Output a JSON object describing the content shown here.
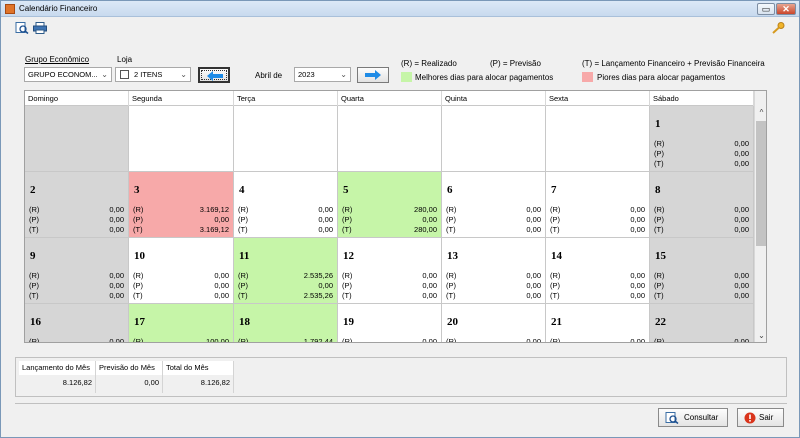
{
  "window": {
    "title": "Calendário Financeiro"
  },
  "filters": {
    "grupo_label": "Grupo Econômico",
    "grupo_value": "GRUPO ECONOM...",
    "loja_label": "Loja",
    "loja_value": "2 ITENS",
    "mes_label": "Abril de",
    "ano_value": "2023"
  },
  "legend": {
    "realizado": "(R) = Realizado",
    "previsao": "(P) = Previsão",
    "total": "(T) = Lançamento Financeiro + Previsão Financeira",
    "best": "Melhores dias para alocar pagamentos",
    "worst": "Piores dias para alocar pagamentos",
    "best_color": "#c6f5a8",
    "worst_color": "#f7a9a9"
  },
  "calendar": {
    "weekdays": [
      "Domingo",
      "Segunda",
      "Terça",
      "Quarta",
      "Quinta",
      "Sexta",
      "Sábado"
    ],
    "rows": [
      [
        {
          "day": "",
          "color": "gray",
          "lines": []
        },
        {
          "day": "",
          "color": "white",
          "lines": []
        },
        {
          "day": "",
          "color": "white",
          "lines": []
        },
        {
          "day": "",
          "color": "white",
          "lines": []
        },
        {
          "day": "",
          "color": "white",
          "lines": []
        },
        {
          "day": "",
          "color": "white",
          "lines": []
        },
        {
          "day": "1",
          "color": "gray",
          "lines": [
            [
              "(R)",
              "0,00"
            ],
            [
              "(P)",
              "0,00"
            ],
            [
              "(T)",
              "0,00"
            ]
          ]
        }
      ],
      [
        {
          "day": "2",
          "color": "gray",
          "lines": [
            [
              "(R)",
              "0,00"
            ],
            [
              "(P)",
              "0,00"
            ],
            [
              "(T)",
              "0,00"
            ]
          ]
        },
        {
          "day": "3",
          "color": "red",
          "lines": [
            [
              "(R)",
              "3.169,12"
            ],
            [
              "(P)",
              "0,00"
            ],
            [
              "(T)",
              "3.169,12"
            ]
          ]
        },
        {
          "day": "4",
          "color": "white",
          "lines": [
            [
              "(R)",
              "0,00"
            ],
            [
              "(P)",
              "0,00"
            ],
            [
              "(T)",
              "0,00"
            ]
          ]
        },
        {
          "day": "5",
          "color": "green",
          "lines": [
            [
              "(R)",
              "280,00"
            ],
            [
              "(P)",
              "0,00"
            ],
            [
              "(T)",
              "280,00"
            ]
          ]
        },
        {
          "day": "6",
          "color": "white",
          "lines": [
            [
              "(R)",
              "0,00"
            ],
            [
              "(P)",
              "0,00"
            ],
            [
              "(T)",
              "0,00"
            ]
          ]
        },
        {
          "day": "7",
          "color": "white",
          "lines": [
            [
              "(R)",
              "0,00"
            ],
            [
              "(P)",
              "0,00"
            ],
            [
              "(T)",
              "0,00"
            ]
          ]
        },
        {
          "day": "8",
          "color": "gray",
          "lines": [
            [
              "(R)",
              "0,00"
            ],
            [
              "(P)",
              "0,00"
            ],
            [
              "(T)",
              "0,00"
            ]
          ]
        }
      ],
      [
        {
          "day": "9",
          "color": "gray",
          "lines": [
            [
              "(R)",
              "0,00"
            ],
            [
              "(P)",
              "0,00"
            ],
            [
              "(T)",
              "0,00"
            ]
          ]
        },
        {
          "day": "10",
          "color": "white",
          "lines": [
            [
              "(R)",
              "0,00"
            ],
            [
              "(P)",
              "0,00"
            ],
            [
              "(T)",
              "0,00"
            ]
          ]
        },
        {
          "day": "11",
          "color": "green",
          "lines": [
            [
              "(R)",
              "2.535,26"
            ],
            [
              "(P)",
              "0,00"
            ],
            [
              "(T)",
              "2.535,26"
            ]
          ]
        },
        {
          "day": "12",
          "color": "white",
          "lines": [
            [
              "(R)",
              "0,00"
            ],
            [
              "(P)",
              "0,00"
            ],
            [
              "(T)",
              "0,00"
            ]
          ]
        },
        {
          "day": "13",
          "color": "white",
          "lines": [
            [
              "(R)",
              "0,00"
            ],
            [
              "(P)",
              "0,00"
            ],
            [
              "(T)",
              "0,00"
            ]
          ]
        },
        {
          "day": "14",
          "color": "white",
          "lines": [
            [
              "(R)",
              "0,00"
            ],
            [
              "(P)",
              "0,00"
            ],
            [
              "(T)",
              "0,00"
            ]
          ]
        },
        {
          "day": "15",
          "color": "gray",
          "lines": [
            [
              "(R)",
              "0,00"
            ],
            [
              "(P)",
              "0,00"
            ],
            [
              "(T)",
              "0,00"
            ]
          ]
        }
      ],
      [
        {
          "day": "16",
          "color": "gray",
          "lines": [
            [
              "(R)",
              "0,00"
            ]
          ]
        },
        {
          "day": "17",
          "color": "green",
          "lines": [
            [
              "(R)",
              "100,00"
            ]
          ]
        },
        {
          "day": "18",
          "color": "green",
          "lines": [
            [
              "(R)",
              "1.792,44"
            ]
          ]
        },
        {
          "day": "19",
          "color": "white",
          "lines": [
            [
              "(R)",
              "0,00"
            ]
          ]
        },
        {
          "day": "20",
          "color": "white",
          "lines": [
            [
              "(R)",
              "0,00"
            ]
          ]
        },
        {
          "day": "21",
          "color": "white",
          "lines": [
            [
              "(R)",
              "0,00"
            ]
          ]
        },
        {
          "day": "22",
          "color": "gray",
          "lines": [
            [
              "(R)",
              "0,00"
            ]
          ]
        }
      ]
    ]
  },
  "totals": {
    "lancamento_label": "Lançamento do Mês",
    "lancamento_value": "8.126,82",
    "previsao_label": "Previsão do Mês",
    "previsao_value": "0,00",
    "total_label": "Total do Mês",
    "total_value": "8.126,82"
  },
  "buttons": {
    "consultar": "Consultar",
    "sair": "Sair"
  }
}
